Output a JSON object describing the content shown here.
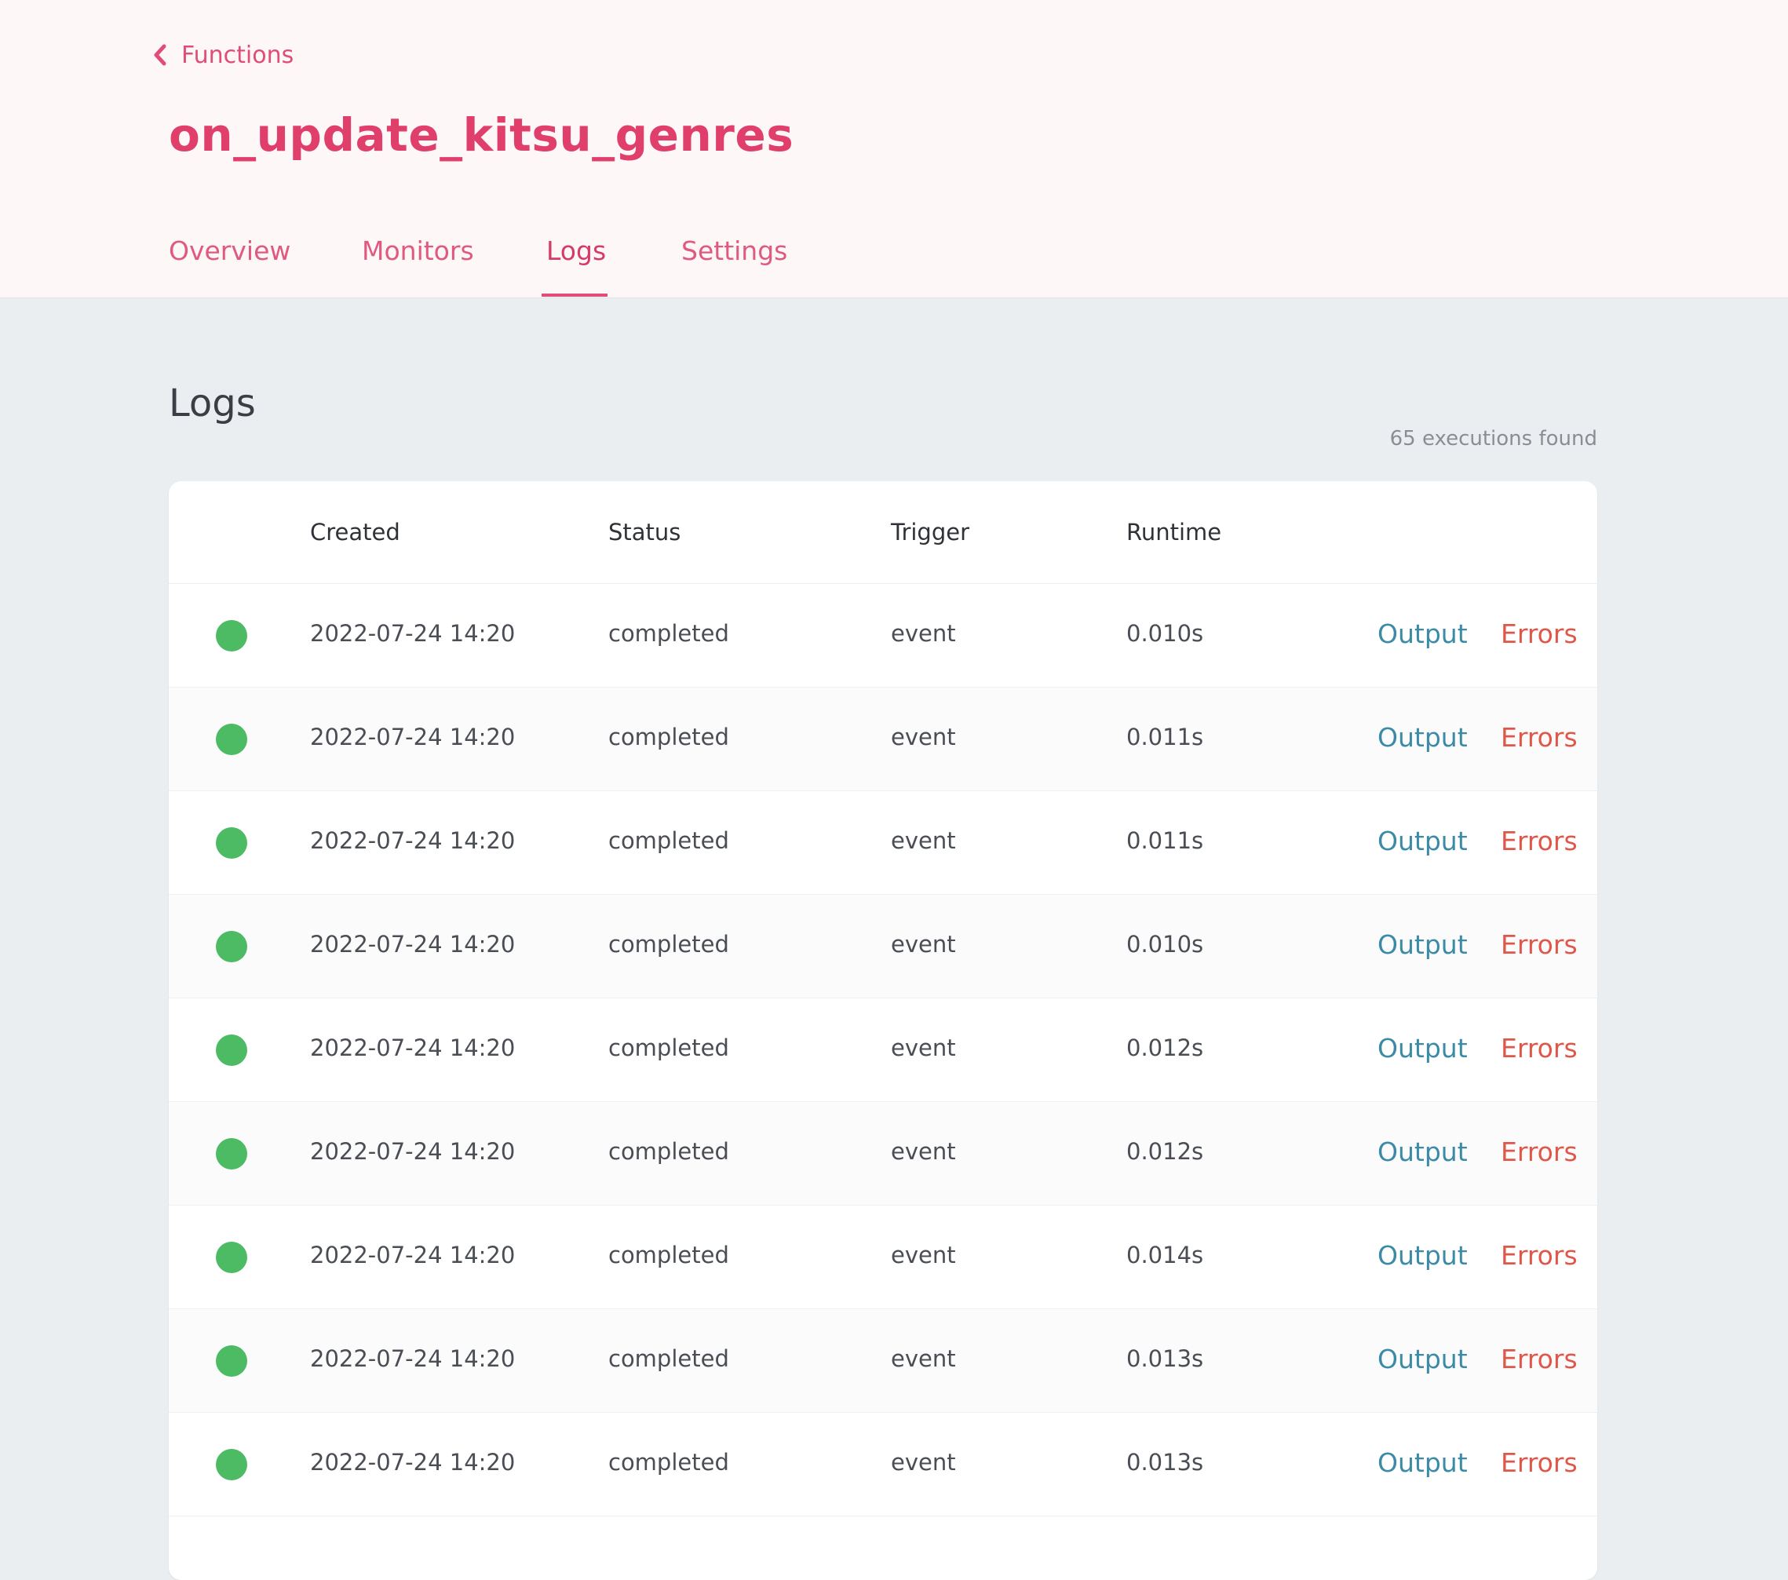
{
  "header": {
    "back_label": "Functions",
    "title": "on_update_kitsu_genres",
    "tabs": [
      {
        "label": "Overview",
        "active": false
      },
      {
        "label": "Monitors",
        "active": false
      },
      {
        "label": "Logs",
        "active": true
      },
      {
        "label": "Settings",
        "active": false
      }
    ]
  },
  "logs": {
    "title": "Logs",
    "count_text": "65 executions found",
    "columns": [
      "Created",
      "Status",
      "Trigger",
      "Runtime"
    ],
    "output_label": "Output",
    "errors_label": "Errors",
    "status_color": "#4cbb64",
    "rows": [
      {
        "created": "2022-07-24 14:20",
        "status": "completed",
        "trigger": "event",
        "runtime": "0.010s"
      },
      {
        "created": "2022-07-24 14:20",
        "status": "completed",
        "trigger": "event",
        "runtime": "0.011s"
      },
      {
        "created": "2022-07-24 14:20",
        "status": "completed",
        "trigger": "event",
        "runtime": "0.011s"
      },
      {
        "created": "2022-07-24 14:20",
        "status": "completed",
        "trigger": "event",
        "runtime": "0.010s"
      },
      {
        "created": "2022-07-24 14:20",
        "status": "completed",
        "trigger": "event",
        "runtime": "0.012s"
      },
      {
        "created": "2022-07-24 14:20",
        "status": "completed",
        "trigger": "event",
        "runtime": "0.012s"
      },
      {
        "created": "2022-07-24 14:20",
        "status": "completed",
        "trigger": "event",
        "runtime": "0.014s"
      },
      {
        "created": "2022-07-24 14:20",
        "status": "completed",
        "trigger": "event",
        "runtime": "0.013s"
      },
      {
        "created": "2022-07-24 14:20",
        "status": "completed",
        "trigger": "event",
        "runtime": "0.013s"
      }
    ]
  },
  "colors": {
    "brand": "#e03f6c",
    "output_link": "#3b8aa6",
    "errors_link": "#e0574a",
    "success": "#4cbb64"
  }
}
